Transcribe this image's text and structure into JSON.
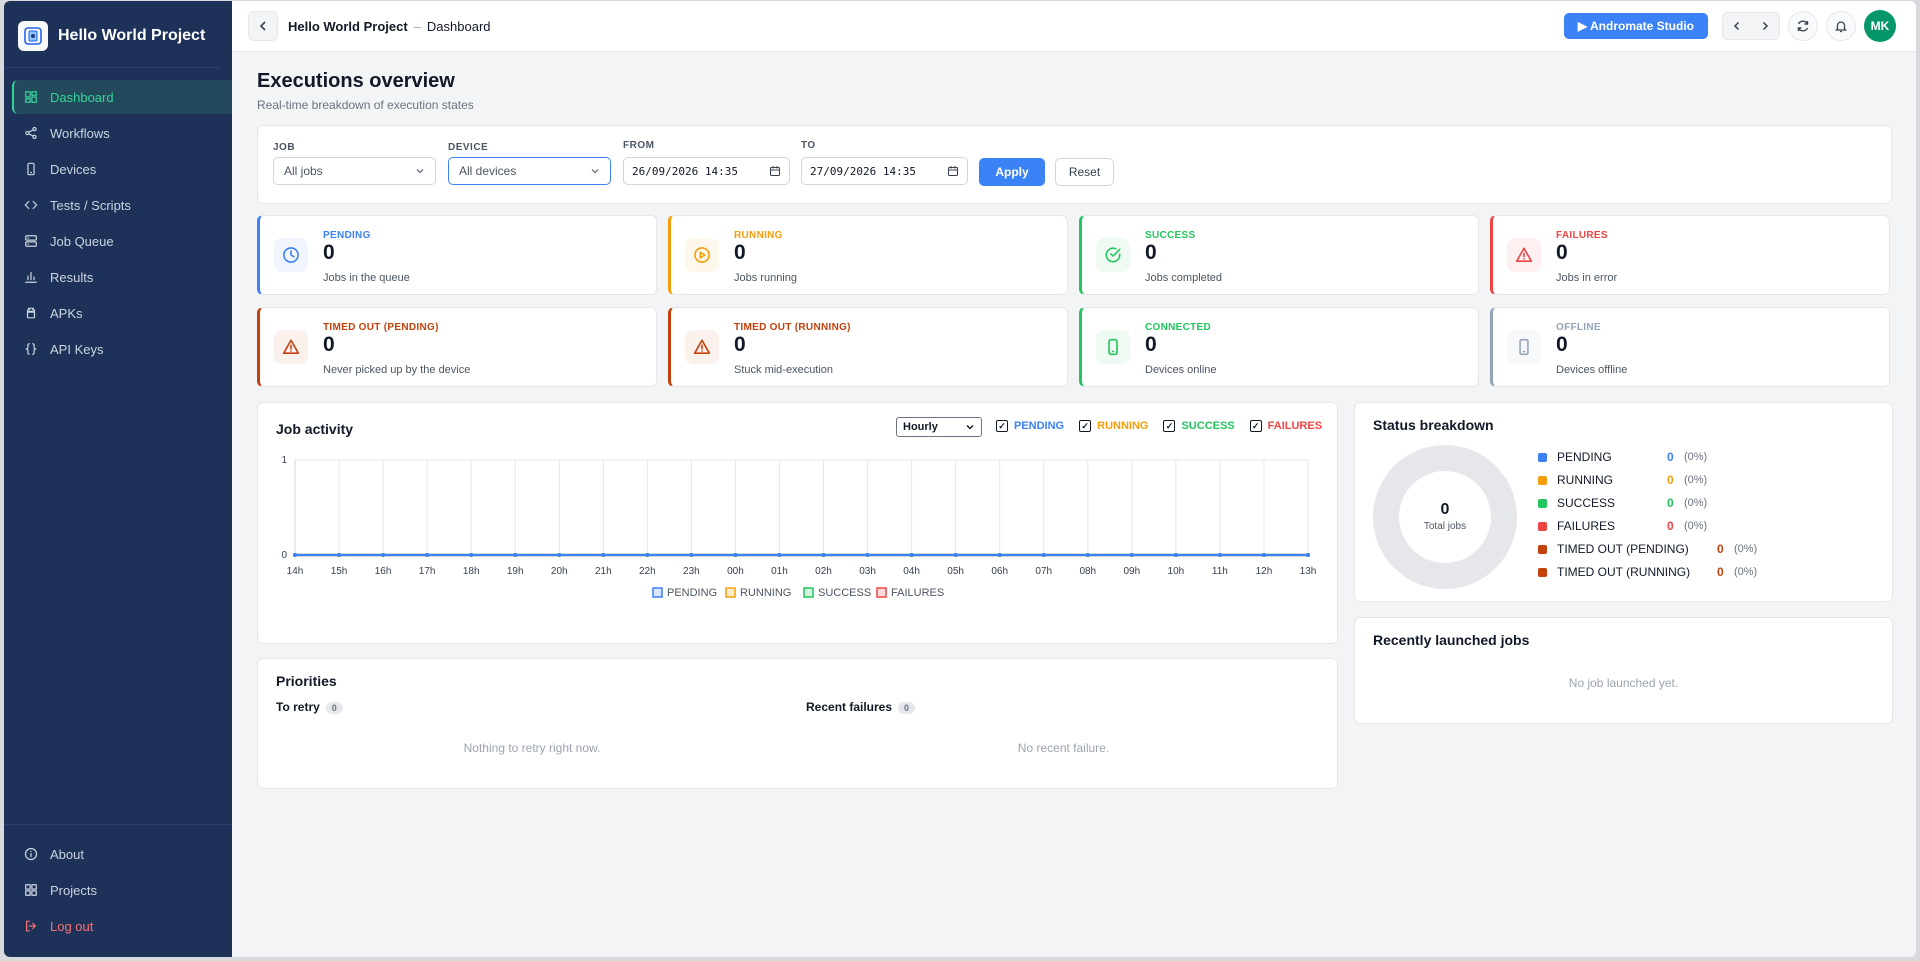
{
  "app": {
    "project_name": "Hello World Project",
    "page_name": "Dashboard",
    "breadcrumb_sep": "–"
  },
  "sidebar": {
    "items": [
      {
        "label": "Dashboard",
        "icon": "dashboard-icon",
        "active": true
      },
      {
        "label": "Workflows",
        "icon": "share-icon"
      },
      {
        "label": "Devices",
        "icon": "phone-icon"
      },
      {
        "label": "Tests / Scripts",
        "icon": "code-icon"
      },
      {
        "label": "Job Queue",
        "icon": "server-icon"
      },
      {
        "label": "Results",
        "icon": "bar-chart-icon"
      },
      {
        "label": "APKs",
        "icon": "android-icon"
      },
      {
        "label": "API Keys",
        "icon": "braces-icon"
      }
    ],
    "bottom_items": [
      {
        "label": "About",
        "icon": "info-icon"
      },
      {
        "label": "Projects",
        "icon": "grid-icon"
      },
      {
        "label": "Log out",
        "icon": "logout-icon"
      }
    ]
  },
  "header": {
    "studio_label": "▶ Andromate Studio",
    "user_initials": "MK"
  },
  "overview": {
    "title": "Executions overview",
    "subtitle": "Real-time breakdown of execution states"
  },
  "filters": {
    "job_label": "JOB",
    "job_value": "All jobs",
    "device_label": "DEVICE",
    "device_value": "All devices",
    "from_label": "FROM",
    "from_value": "26/09/2026 14:35",
    "to_label": "TO",
    "to_value": "27/09/2026 14:35",
    "apply_label": "Apply",
    "reset_label": "Reset"
  },
  "stats": [
    {
      "label": "PENDING",
      "value": "0",
      "desc": "Jobs in the queue",
      "color": "#3b82f6",
      "icon": "clock-icon"
    },
    {
      "label": "RUNNING",
      "value": "0",
      "desc": "Jobs running",
      "color": "#f59e0b",
      "icon": "play-circle-icon"
    },
    {
      "label": "SUCCESS",
      "value": "0",
      "desc": "Jobs completed",
      "color": "#22c55e",
      "icon": "check-circle-icon"
    },
    {
      "label": "FAILURES",
      "value": "0",
      "desc": "Jobs in error",
      "color": "#ef4444",
      "icon": "warning-icon"
    },
    {
      "label": "TIMED OUT (PENDING)",
      "value": "0",
      "desc": "Never picked up by the device",
      "color": "#c2410c",
      "icon": "warning-icon"
    },
    {
      "label": "TIMED OUT (RUNNING)",
      "value": "0",
      "desc": "Stuck mid-execution",
      "color": "#c2410c",
      "icon": "warning-icon"
    },
    {
      "label": "CONNECTED",
      "value": "0",
      "desc": "Devices online",
      "color": "#22c55e",
      "icon": "phone-icon"
    },
    {
      "label": "OFFLINE",
      "value": "0",
      "desc": "Devices offline",
      "color": "#94a3b8",
      "icon": "phone-icon"
    }
  ],
  "job_activity": {
    "title": "Job activity",
    "granularity": "Hourly",
    "toggles": [
      {
        "label": "PENDING",
        "color": "#3b82f6"
      },
      {
        "label": "RUNNING",
        "color": "#f59e0b"
      },
      {
        "label": "SUCCESS",
        "color": "#22c55e"
      },
      {
        "label": "FAILURES",
        "color": "#ef4444"
      }
    ]
  },
  "chart_data": {
    "type": "line",
    "x": [
      "14h",
      "15h",
      "16h",
      "17h",
      "18h",
      "19h",
      "20h",
      "21h",
      "22h",
      "23h",
      "00h",
      "01h",
      "02h",
      "03h",
      "04h",
      "05h",
      "06h",
      "07h",
      "08h",
      "09h",
      "10h",
      "11h",
      "12h",
      "13h"
    ],
    "series": [
      {
        "name": "PENDING",
        "color": "#3b82f6",
        "values": [
          0,
          0,
          0,
          0,
          0,
          0,
          0,
          0,
          0,
          0,
          0,
          0,
          0,
          0,
          0,
          0,
          0,
          0,
          0,
          0,
          0,
          0,
          0,
          0
        ]
      },
      {
        "name": "RUNNING",
        "color": "#f59e0b",
        "values": [
          0,
          0,
          0,
          0,
          0,
          0,
          0,
          0,
          0,
          0,
          0,
          0,
          0,
          0,
          0,
          0,
          0,
          0,
          0,
          0,
          0,
          0,
          0,
          0
        ]
      },
      {
        "name": "SUCCESS",
        "color": "#22c55e",
        "values": [
          0,
          0,
          0,
          0,
          0,
          0,
          0,
          0,
          0,
          0,
          0,
          0,
          0,
          0,
          0,
          0,
          0,
          0,
          0,
          0,
          0,
          0,
          0,
          0
        ]
      },
      {
        "name": "FAILURES",
        "color": "#ef4444",
        "values": [
          0,
          0,
          0,
          0,
          0,
          0,
          0,
          0,
          0,
          0,
          0,
          0,
          0,
          0,
          0,
          0,
          0,
          0,
          0,
          0,
          0,
          0,
          0,
          0
        ]
      }
    ],
    "yticks": [
      "0",
      "1"
    ],
    "ylim": [
      0,
      1
    ],
    "grid": true,
    "legend": "bottom"
  },
  "status_breakdown": {
    "title": "Status breakdown",
    "total": "0",
    "total_label": "Total jobs",
    "rows": [
      {
        "label": "PENDING",
        "count": "0",
        "pct": "(0%)",
        "color": "#3b82f6"
      },
      {
        "label": "RUNNING",
        "count": "0",
        "pct": "(0%)",
        "color": "#f59e0b"
      },
      {
        "label": "SUCCESS",
        "count": "0",
        "pct": "(0%)",
        "color": "#22c55e"
      },
      {
        "label": "FAILURES",
        "count": "0",
        "pct": "(0%)",
        "color": "#ef4444"
      },
      {
        "label": "TIMED OUT (PENDING)",
        "count": "0",
        "pct": "(0%)",
        "color": "#c2410c"
      },
      {
        "label": "TIMED OUT (RUNNING)",
        "count": "0",
        "pct": "(0%)",
        "color": "#c2410c"
      }
    ]
  },
  "priorities": {
    "title": "Priorities",
    "retry_label": "To retry",
    "retry_count": "0",
    "retry_empty": "Nothing to retry right now.",
    "failures_label": "Recent failures",
    "failures_count": "0",
    "failures_empty": "No recent failure."
  },
  "recent": {
    "title": "Recently launched jobs",
    "empty": "No job launched yet."
  }
}
